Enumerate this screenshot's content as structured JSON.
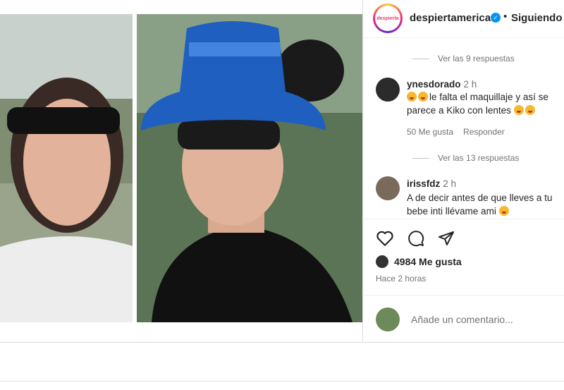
{
  "post": {
    "image_description_icon": "photo-collage"
  },
  "header": {
    "account": "despiertamerica",
    "verified_icon": "verified-badge-icon",
    "separator": "•",
    "follow_label": "Siguiendo",
    "avatar_text": "despierta"
  },
  "comments": {
    "replies_1": "Ver las 9 respuestas",
    "c1": {
      "user": "ynesdorado",
      "time": "2 h",
      "line1": "le falta el maquillaje y así se",
      "line2": "parece a Kiko con lentes",
      "likes": "50 Me gusta",
      "reply": "Responder"
    },
    "replies_2": "Ver las 13 respuestas",
    "c2": {
      "user": "irissfdz",
      "time": "2 h",
      "line1": "A de decir antes de que lleves a tu",
      "line2": "bebe inti llévame ami"
    }
  },
  "actions": {
    "like_icon": "heart-icon",
    "comment_icon": "comment-icon",
    "share_icon": "share-icon"
  },
  "stats": {
    "likes": "4984 Me gusta",
    "time": "Hace 2 horas"
  },
  "add_comment": {
    "placeholder": "Añade un comentario..."
  },
  "colors": {
    "accent": "#0095f6",
    "text": "#262626",
    "muted": "#737373"
  }
}
